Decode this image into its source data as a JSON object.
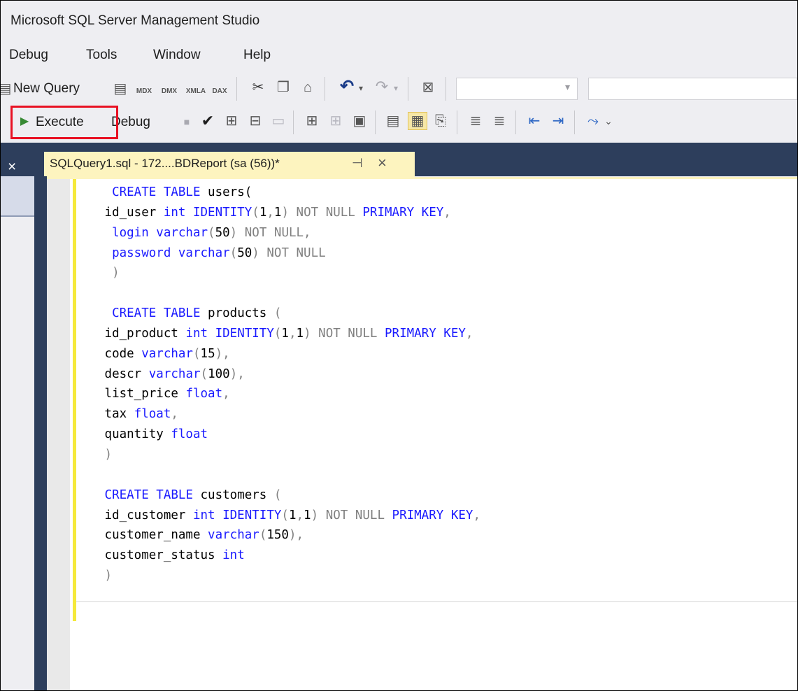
{
  "window": {
    "title": "Microsoft SQL Server Management Studio"
  },
  "menu": {
    "items": [
      "Debug",
      "Tools",
      "Window",
      "Help"
    ]
  },
  "toolbar1": {
    "new_query_label": "New Query",
    "icons": [
      "new-query-icon",
      "database-engine-query-icon",
      "analysis-services-mdx-icon",
      "analysis-services-dmx-icon",
      "analysis-services-xmla-icon",
      "analysis-services-dax-icon",
      "cut-icon",
      "copy-icon",
      "paste-icon",
      "undo-icon",
      "redo-icon",
      "activity-monitor-icon"
    ],
    "undo_glyph": "↶",
    "redo_glyph": "↷",
    "dropdown_glyph": "▾",
    "mdx": "MDX",
    "dmx": "DMX",
    "xmla": "XMLA",
    "dax": "DAX"
  },
  "toolbar2": {
    "execute_label": "Execute",
    "debug_label": "Debug",
    "execute_glyph": "▶",
    "check_glyph": "✔",
    "overflow_glyph": "⌄"
  },
  "tab": {
    "label": "SQLQuery1.sql - 172....BDReport (sa (56))*",
    "pin_glyph": "⊣",
    "close_glyph": "×"
  },
  "panel_close_glyph": "×",
  "colors": {
    "keyword": "#1a1aff",
    "operator": "#808080",
    "tab_bg": "#fdf4bf",
    "accent_dark": "#2d3e5c",
    "highlight_border": "#e81123"
  },
  "editor": {
    "lines": [
      "CREATE TABLE users(",
      "id_user int IDENTITY(1,1) NOT NULL PRIMARY KEY,",
      "login varchar(50) NOT NULL,",
      "password varchar(50) NOT NULL",
      ")",
      "",
      "CREATE TABLE products (",
      "id_product int IDENTITY(1,1) NOT NULL PRIMARY KEY,",
      "code varchar(15),",
      "descr varchar(100),",
      "list_price float,",
      "tax float,",
      "quantity float",
      ")",
      "",
      "CREATE TABLE customers (",
      "id_customer int IDENTITY(1,1) NOT NULL PRIMARY KEY,",
      "customer_name varchar(150),",
      "customer_status int",
      ")"
    ]
  }
}
